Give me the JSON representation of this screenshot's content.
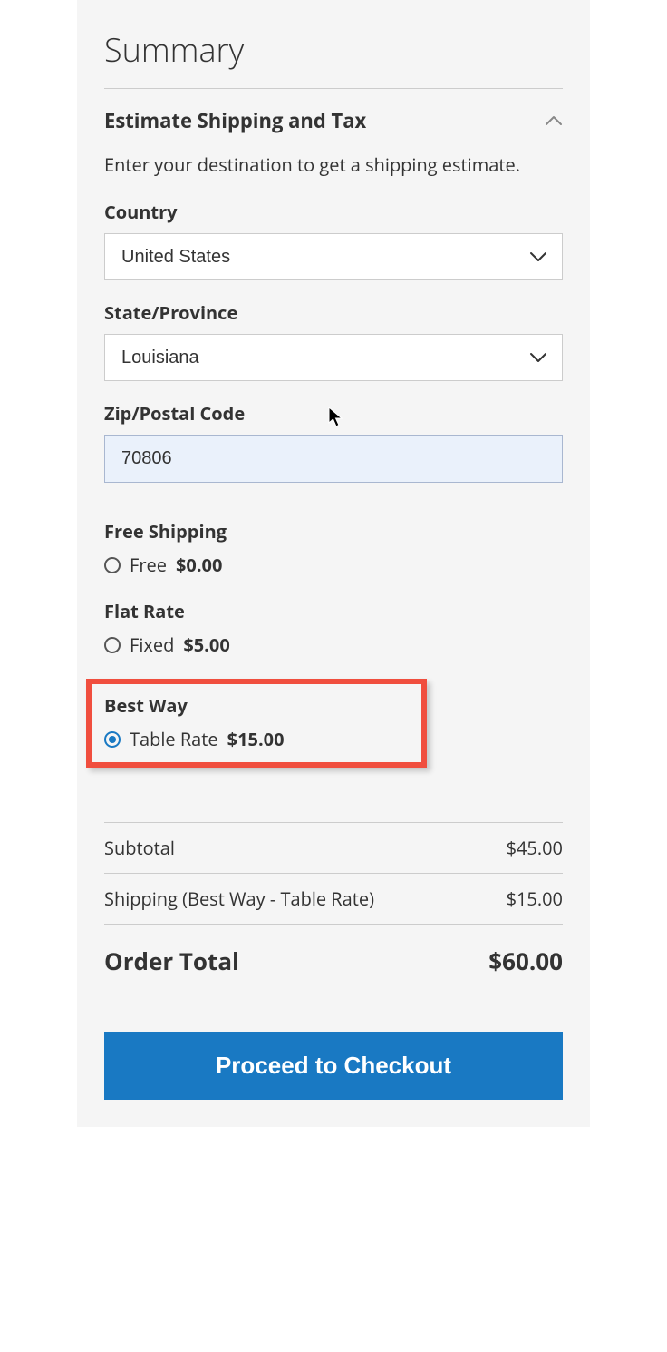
{
  "summary_title": "Summary",
  "estimate": {
    "title": "Estimate Shipping and Tax",
    "instruction": "Enter your destination to get a shipping estimate.",
    "country_label": "Country",
    "country_value": "United States",
    "state_label": "State/Province",
    "state_value": "Louisiana",
    "zip_label": "Zip/Postal Code",
    "zip_value": "70806"
  },
  "shipping": {
    "free": {
      "title": "Free Shipping",
      "option_label": "Free",
      "option_price": "$0.00",
      "selected": false
    },
    "flat": {
      "title": "Flat Rate",
      "option_label": "Fixed",
      "option_price": "$5.00",
      "selected": false
    },
    "best": {
      "title": "Best Way",
      "option_label": "Table Rate",
      "option_price": "$15.00",
      "selected": true
    }
  },
  "totals": {
    "subtotal_label": "Subtotal",
    "subtotal_value": "$45.00",
    "shipping_label": "Shipping (Best Way - Table Rate)",
    "shipping_value": "$15.00",
    "order_total_label": "Order Total",
    "order_total_value": "$60.00"
  },
  "checkout_label": "Proceed to Checkout"
}
